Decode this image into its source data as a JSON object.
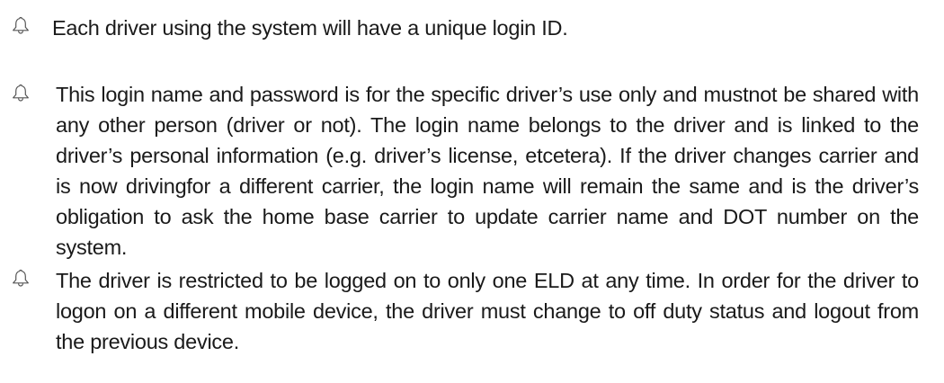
{
  "bullets": [
    {
      "icon": "bell-outline-icon",
      "text": "Each driver using the system will have a unique login ID."
    },
    {
      "icon": "bell-outline-icon",
      "text": "This login name and password is for the specific driver’s use only and mustnot be shared with any other person (driver or not). The login name belongs to the driver and is linked to the driver’s personal information (e.g. driver’s license, etcetera). If the driver changes carrier and is now drivingfor a different carrier, the login name will remain the same and is the driver’s obligation to ask the home base carrier to update carrier name and DOT number on the system."
    },
    {
      "icon": "bell-outline-icon",
      "text": "The driver is restricted to be logged on to only one ELD at any time. In order for the driver to logon on a different mobile device, the driver must change to off duty status and logout from the previous device."
    }
  ],
  "colors": {
    "text": "#1a1a1a",
    "icon_stroke": "#555555"
  }
}
